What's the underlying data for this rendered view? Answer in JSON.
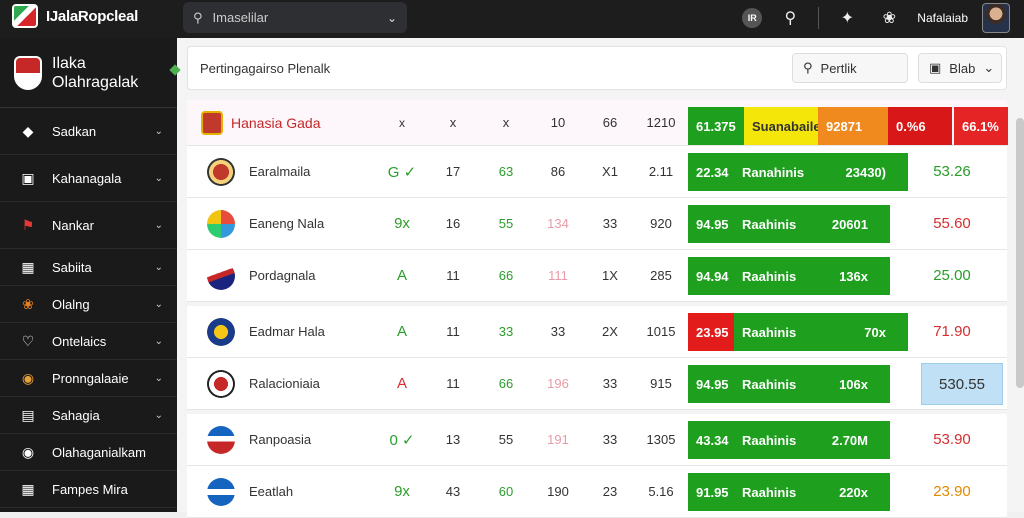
{
  "topbar": {
    "brand": "IJalaRopcleal",
    "search_value": "Imaselilar",
    "badge": "IR",
    "user_name": "Nafalaiab"
  },
  "sidebar": {
    "title_line1": "Ilaka",
    "title_line2": "Olahragalak",
    "items": [
      {
        "label": "Sadkan",
        "icon": "shield-icon"
      },
      {
        "label": "Kahanagala",
        "icon": "door-icon"
      },
      {
        "label": "Nankar",
        "icon": "flag-icon"
      },
      {
        "label": "Sabiita",
        "icon": "calendar-icon"
      },
      {
        "label": "Olalng",
        "icon": "ball-icon"
      },
      {
        "label": "Ontelaics",
        "icon": "heart-icon"
      },
      {
        "label": "Pronngalaaie",
        "icon": "target-icon"
      },
      {
        "label": "Sahagia",
        "icon": "card-icon"
      },
      {
        "label": "Olahaganialkam",
        "icon": "globe-icon"
      },
      {
        "label": "Fampes Mira",
        "icon": "grid-icon"
      }
    ]
  },
  "filterbar": {
    "label": "Pertingagairso Plenalk",
    "search_btn": "Pertlik",
    "dropdown_btn": "Blab"
  },
  "table": {
    "header": {
      "name": "Hanasia Gada",
      "cols": [
        "x",
        "x",
        "x",
        "10",
        "66",
        "1210"
      ],
      "bars": [
        "61.375",
        "Suanabaile",
        "92871",
        "0.%6",
        "66.1%"
      ]
    },
    "rows": [
      {
        "name": "Earalmaila",
        "c1": "G ✓",
        "c2": "17",
        "c3": "63",
        "c4": "86",
        "c5": "X1",
        "c6": "2.11",
        "b1": "22.34",
        "b2": "Ranahinis",
        "b3": "23430)",
        "price": "53.26",
        "b1color": "#1e9f1e",
        "pc": "green",
        "c1c": "green",
        "c3c": "green",
        "c4c": ""
      },
      {
        "name": "Eaneng Nala",
        "c1": "9x",
        "c2": "16",
        "c3": "55",
        "c4": "134",
        "c5": "33",
        "c6": "920",
        "b1": "94.95",
        "b2": "Raahinis",
        "b3": "20601",
        "price": "55.60",
        "b1color": "#1e9f1e",
        "pc": "red",
        "c1c": "green",
        "c3c": "green",
        "c4c": "pink"
      },
      {
        "name": "Pordagnala",
        "c1": "A",
        "c2": "11",
        "c3": "66",
        "c4": "111",
        "c5": "1X",
        "c6": "285",
        "b1": "94.94",
        "b2": "Raahinis",
        "b3": "136x",
        "price": "25.00",
        "b1color": "#1e9f1e",
        "pc": "green",
        "c1c": "green",
        "c3c": "green",
        "c4c": "pink"
      },
      {
        "name": "Eadmar Hala",
        "c1": "A",
        "c2": "11",
        "c3": "33",
        "c4": "33",
        "c5": "2X",
        "c6": "1015",
        "b1": "23.95",
        "b2": "Raahinis",
        "b3": "70x",
        "price": "71.90",
        "b1color": "#e21b1b",
        "pc": "red",
        "c1c": "green",
        "c3c": "green",
        "c4c": ""
      },
      {
        "name": "Ralacioniaia",
        "c1": "A",
        "c2": "11",
        "c3": "66",
        "c4": "196",
        "c5": "33",
        "c6": "915",
        "b1": "94.95",
        "b2": "Raahinis",
        "b3": "106x",
        "price": "530.55",
        "b1color": "#1e9f1e",
        "pc": "box",
        "c1c": "red",
        "c3c": "green",
        "c4c": "pink"
      },
      {
        "name": "Ranpoasia",
        "c1": "0 ✓",
        "c2": "13",
        "c3": "55",
        "c4": "191",
        "c5": "33",
        "c6": "1305",
        "b1": "43.34",
        "b2": "Raahinis",
        "b3": "2.70M",
        "price": "53.90",
        "b1color": "#1e9f1e",
        "pc": "red",
        "c1c": "green",
        "c3c": "",
        "c4c": "pink"
      },
      {
        "name": "Eeatlah",
        "c1": "9x",
        "c2": "43",
        "c3": "60",
        "c4": "190",
        "c5": "23",
        "c6": "5.16",
        "b1": "91.95",
        "b2": "Raahinis",
        "b3": "220x",
        "price": "23.90",
        "b1color": "#1e9f1e",
        "pc": "orange",
        "c1c": "green",
        "c3c": "green",
        "c4c": ""
      }
    ]
  }
}
